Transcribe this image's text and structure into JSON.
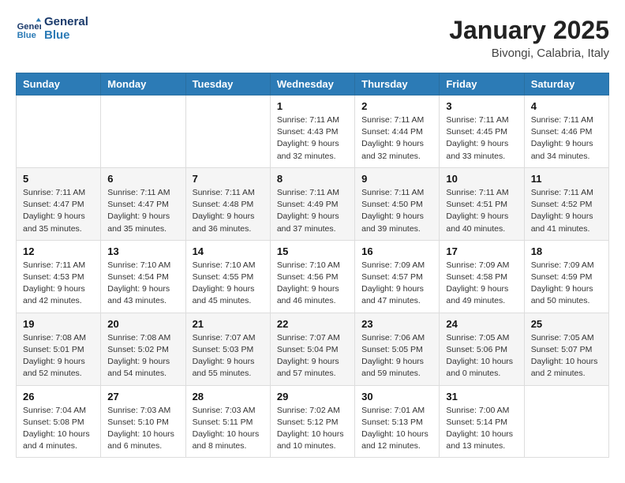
{
  "header": {
    "logo_line1": "General",
    "logo_line2": "Blue",
    "month": "January 2025",
    "location": "Bivongi, Calabria, Italy"
  },
  "weekdays": [
    "Sunday",
    "Monday",
    "Tuesday",
    "Wednesday",
    "Thursday",
    "Friday",
    "Saturday"
  ],
  "weeks": [
    [
      {
        "day": "",
        "info": ""
      },
      {
        "day": "",
        "info": ""
      },
      {
        "day": "",
        "info": ""
      },
      {
        "day": "1",
        "info": "Sunrise: 7:11 AM\nSunset: 4:43 PM\nDaylight: 9 hours\nand 32 minutes."
      },
      {
        "day": "2",
        "info": "Sunrise: 7:11 AM\nSunset: 4:44 PM\nDaylight: 9 hours\nand 32 minutes."
      },
      {
        "day": "3",
        "info": "Sunrise: 7:11 AM\nSunset: 4:45 PM\nDaylight: 9 hours\nand 33 minutes."
      },
      {
        "day": "4",
        "info": "Sunrise: 7:11 AM\nSunset: 4:46 PM\nDaylight: 9 hours\nand 34 minutes."
      }
    ],
    [
      {
        "day": "5",
        "info": "Sunrise: 7:11 AM\nSunset: 4:47 PM\nDaylight: 9 hours\nand 35 minutes."
      },
      {
        "day": "6",
        "info": "Sunrise: 7:11 AM\nSunset: 4:47 PM\nDaylight: 9 hours\nand 35 minutes."
      },
      {
        "day": "7",
        "info": "Sunrise: 7:11 AM\nSunset: 4:48 PM\nDaylight: 9 hours\nand 36 minutes."
      },
      {
        "day": "8",
        "info": "Sunrise: 7:11 AM\nSunset: 4:49 PM\nDaylight: 9 hours\nand 37 minutes."
      },
      {
        "day": "9",
        "info": "Sunrise: 7:11 AM\nSunset: 4:50 PM\nDaylight: 9 hours\nand 39 minutes."
      },
      {
        "day": "10",
        "info": "Sunrise: 7:11 AM\nSunset: 4:51 PM\nDaylight: 9 hours\nand 40 minutes."
      },
      {
        "day": "11",
        "info": "Sunrise: 7:11 AM\nSunset: 4:52 PM\nDaylight: 9 hours\nand 41 minutes."
      }
    ],
    [
      {
        "day": "12",
        "info": "Sunrise: 7:11 AM\nSunset: 4:53 PM\nDaylight: 9 hours\nand 42 minutes."
      },
      {
        "day": "13",
        "info": "Sunrise: 7:10 AM\nSunset: 4:54 PM\nDaylight: 9 hours\nand 43 minutes."
      },
      {
        "day": "14",
        "info": "Sunrise: 7:10 AM\nSunset: 4:55 PM\nDaylight: 9 hours\nand 45 minutes."
      },
      {
        "day": "15",
        "info": "Sunrise: 7:10 AM\nSunset: 4:56 PM\nDaylight: 9 hours\nand 46 minutes."
      },
      {
        "day": "16",
        "info": "Sunrise: 7:09 AM\nSunset: 4:57 PM\nDaylight: 9 hours\nand 47 minutes."
      },
      {
        "day": "17",
        "info": "Sunrise: 7:09 AM\nSunset: 4:58 PM\nDaylight: 9 hours\nand 49 minutes."
      },
      {
        "day": "18",
        "info": "Sunrise: 7:09 AM\nSunset: 4:59 PM\nDaylight: 9 hours\nand 50 minutes."
      }
    ],
    [
      {
        "day": "19",
        "info": "Sunrise: 7:08 AM\nSunset: 5:01 PM\nDaylight: 9 hours\nand 52 minutes."
      },
      {
        "day": "20",
        "info": "Sunrise: 7:08 AM\nSunset: 5:02 PM\nDaylight: 9 hours\nand 54 minutes."
      },
      {
        "day": "21",
        "info": "Sunrise: 7:07 AM\nSunset: 5:03 PM\nDaylight: 9 hours\nand 55 minutes."
      },
      {
        "day": "22",
        "info": "Sunrise: 7:07 AM\nSunset: 5:04 PM\nDaylight: 9 hours\nand 57 minutes."
      },
      {
        "day": "23",
        "info": "Sunrise: 7:06 AM\nSunset: 5:05 PM\nDaylight: 9 hours\nand 59 minutes."
      },
      {
        "day": "24",
        "info": "Sunrise: 7:05 AM\nSunset: 5:06 PM\nDaylight: 10 hours\nand 0 minutes."
      },
      {
        "day": "25",
        "info": "Sunrise: 7:05 AM\nSunset: 5:07 PM\nDaylight: 10 hours\nand 2 minutes."
      }
    ],
    [
      {
        "day": "26",
        "info": "Sunrise: 7:04 AM\nSunset: 5:08 PM\nDaylight: 10 hours\nand 4 minutes."
      },
      {
        "day": "27",
        "info": "Sunrise: 7:03 AM\nSunset: 5:10 PM\nDaylight: 10 hours\nand 6 minutes."
      },
      {
        "day": "28",
        "info": "Sunrise: 7:03 AM\nSunset: 5:11 PM\nDaylight: 10 hours\nand 8 minutes."
      },
      {
        "day": "29",
        "info": "Sunrise: 7:02 AM\nSunset: 5:12 PM\nDaylight: 10 hours\nand 10 minutes."
      },
      {
        "day": "30",
        "info": "Sunrise: 7:01 AM\nSunset: 5:13 PM\nDaylight: 10 hours\nand 12 minutes."
      },
      {
        "day": "31",
        "info": "Sunrise: 7:00 AM\nSunset: 5:14 PM\nDaylight: 10 hours\nand 13 minutes."
      },
      {
        "day": "",
        "info": ""
      }
    ]
  ]
}
